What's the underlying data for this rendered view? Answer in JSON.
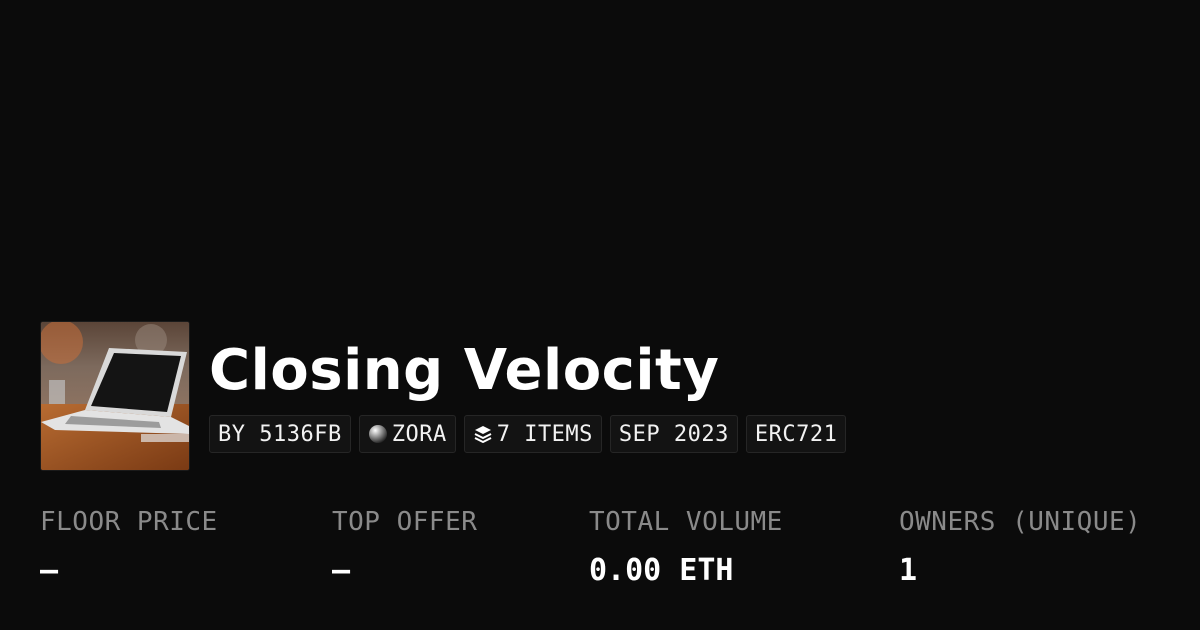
{
  "collection": {
    "title": "Closing Velocity",
    "thumbnail_icon": "laptop-photo",
    "badges": {
      "creator": "BY 5136FB",
      "chain": "ZORA",
      "chain_icon": "zora-orb-icon",
      "items": "7 ITEMS",
      "items_icon": "layers-icon",
      "date": "SEP 2023",
      "standard": "ERC721"
    }
  },
  "stats": {
    "floor_price": {
      "label": "FLOOR PRICE",
      "value": "–"
    },
    "top_offer": {
      "label": "TOP OFFER",
      "value": "–"
    },
    "total_volume": {
      "label": "TOTAL VOLUME",
      "value": "0.00 ETH"
    },
    "owners": {
      "label": "OWNERS (UNIQUE)",
      "value": "1"
    }
  }
}
